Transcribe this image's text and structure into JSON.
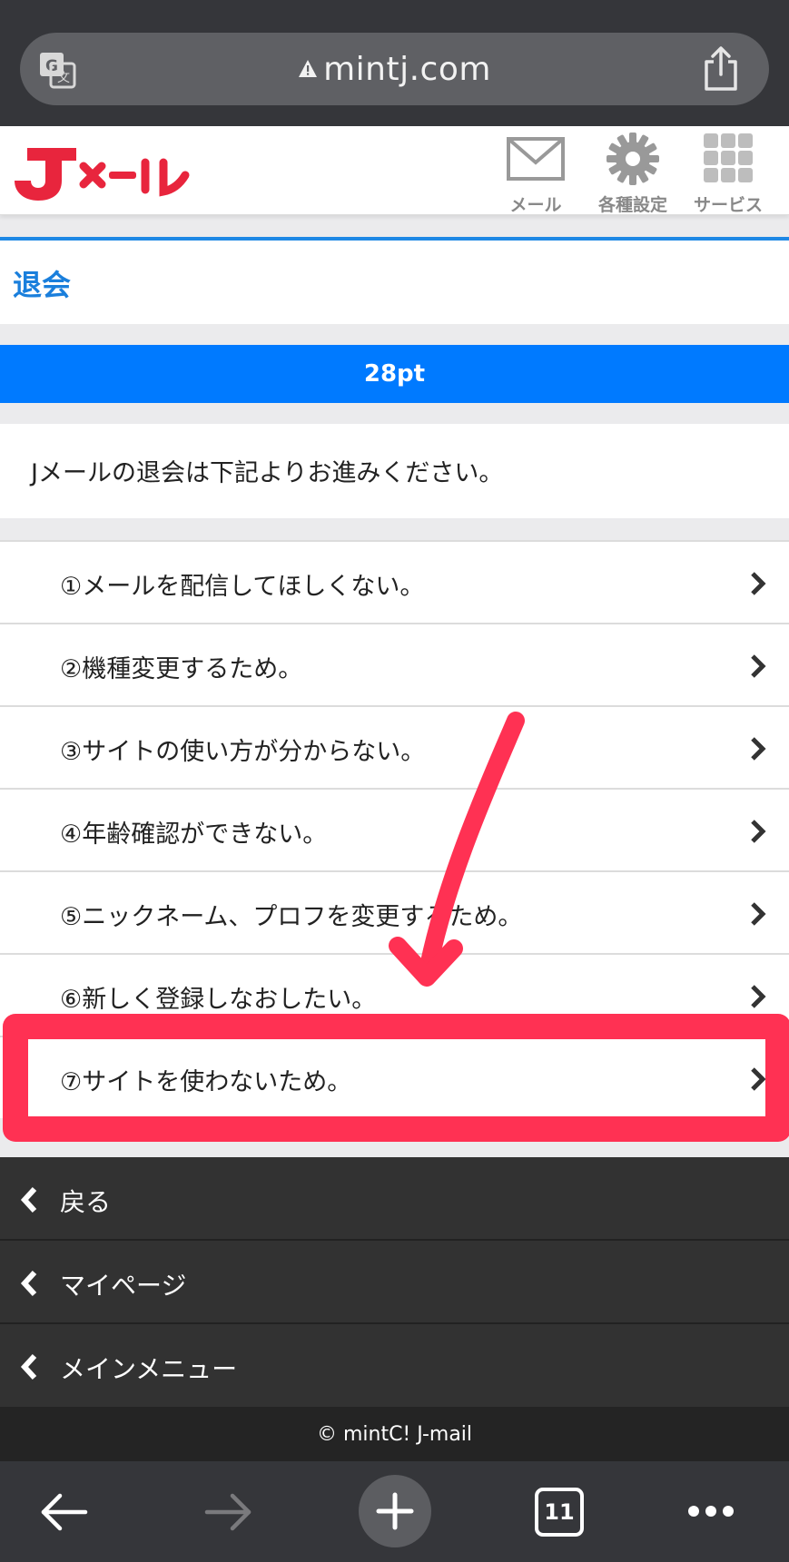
{
  "browser": {
    "url": "mintj.com",
    "tab_count": "11"
  },
  "header": {
    "logo_text": "Jメール",
    "nav": [
      {
        "label": "メール",
        "icon": "mail-icon"
      },
      {
        "label": "各種設定",
        "icon": "gear-icon"
      },
      {
        "label": "サービス",
        "icon": "grid-icon"
      }
    ]
  },
  "page": {
    "title": "退会",
    "points": "28pt",
    "intro": "Jメールの退会は下記よりお進みください。"
  },
  "reasons": [
    {
      "label": "①メールを配信してほしくない。"
    },
    {
      "label": "②機種変更するため。"
    },
    {
      "label": "③サイトの使い方が分からない。"
    },
    {
      "label": "④年齢確認ができない。"
    },
    {
      "label": "⑤ニックネーム、プロフを変更するため。"
    },
    {
      "label": "⑥新しく登録しなおしたい。"
    },
    {
      "label": "⑦サイトを使わないため。"
    }
  ],
  "footer": {
    "items": [
      {
        "label": "戻る"
      },
      {
        "label": "マイページ"
      },
      {
        "label": "メインメニュー"
      }
    ],
    "copyright": "© mintC! J-mail"
  },
  "colors": {
    "accent": "#007aff",
    "highlight": "#ff3153",
    "logo": "#e8253d"
  }
}
